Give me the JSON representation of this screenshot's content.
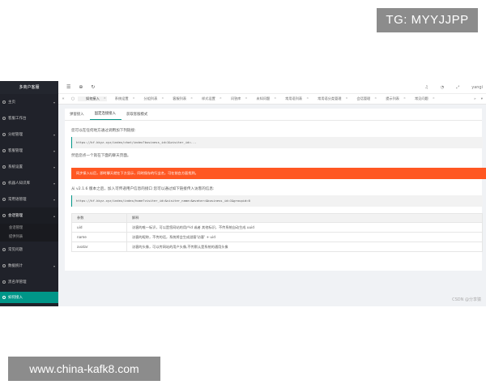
{
  "watermarks": {
    "top": "TG: MYYJJPP",
    "bottom": "www.china-kafk8.com",
    "csdn": "CSDN @分享猿"
  },
  "sidebar": {
    "logo": "多商户客服",
    "items": [
      {
        "label": "主页",
        "has_children": true
      },
      {
        "label": "客服工作台",
        "has_children": false
      },
      {
        "label": "分组管理",
        "has_children": true
      },
      {
        "label": "客服管理",
        "has_children": true
      },
      {
        "label": "系统设置",
        "has_children": true
      },
      {
        "label": "机器人知识库",
        "has_children": true
      },
      {
        "label": "常用语管理",
        "has_children": true
      },
      {
        "label": "会话管理",
        "has_children": true
      }
    ],
    "open_sub": [
      "会话管理",
      "提供列表"
    ],
    "items_after": [
      {
        "label": "常见问题",
        "has_children": false
      },
      {
        "label": "数据统计",
        "has_children": true
      },
      {
        "label": "黑名单管理",
        "has_children": false
      }
    ],
    "active_item": "如何接入"
  },
  "topbar": {
    "user": "yangi"
  },
  "tabs": [
    "如何接入",
    "系统设置",
    "分组列表",
    "客服列表",
    "样式设置",
    "问答库",
    "未知问题",
    "常用语列表",
    "常用语分类管理",
    "会话管理",
    "提示列表",
    "常见问题"
  ],
  "content": {
    "subtabs": [
      "弹窗接入",
      "固定连接接入",
      "获取客服模式"
    ],
    "line1": "您可以在任何地方通过调用加下列链接:",
    "code1": "https://kf.kkyz.xyz/index/chat/index?business_id=1&visiter_id=...",
    "line2": "然后您点一个就在下面的聊天页面。",
    "alert": "同步接入以后，即时聊天就在下方显示，同时保存的行业名，可在前台方面找到。",
    "line3": "从 v2.1.6 版本之后，加入可传递用户信息的接口 您可以通过如下链接传入访客的信息:",
    "code2": "https://kf.kkyz.xyz/index/index/home?visiter_id=&visiter_name=&avatar=&business_id=1&groupid=0",
    "table": {
      "headers": [
        "参数",
        "解释"
      ],
      "rows": [
        [
          "uid",
          "访客的唯一标识，可以是您网站的用户id 或者 其他标识，不传系统自动生成 uuid"
        ],
        [
          "name",
          "访客的昵称，不传的话，系统将会生成游客'访客' + uid"
        ],
        [
          "avatar",
          "访客的头像，可以传网站的用户头像,不传默认是系统的通用头像"
        ]
      ]
    }
  }
}
